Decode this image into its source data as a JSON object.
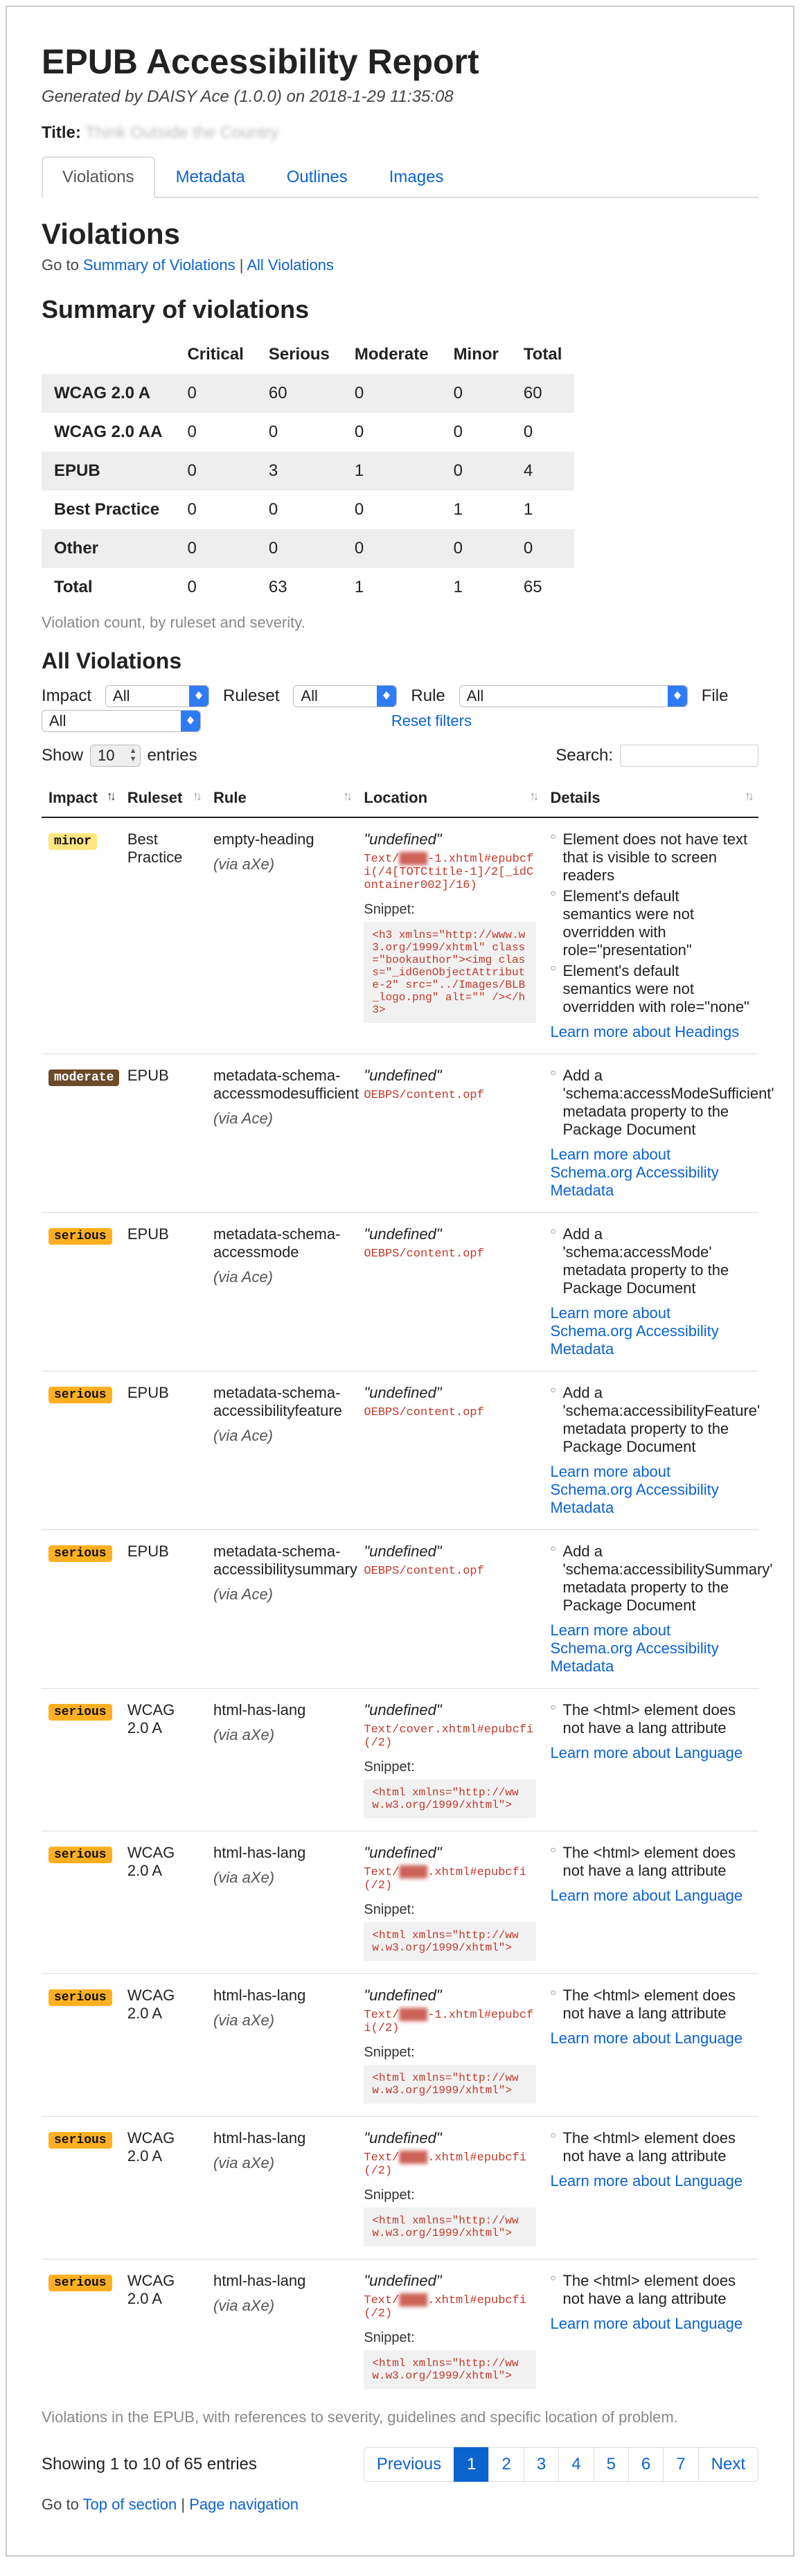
{
  "header": {
    "h1": "EPUB Accessibility Report",
    "generated_prefix": "Generated by ",
    "generated_tool": "DAISY Ace (1.0.0)",
    "generated_on": " on 2018-1-29 11:35:08",
    "title_label": "Title:",
    "title_value": "Think Outside the Country"
  },
  "tabs": [
    "Violations",
    "Metadata",
    "Outlines",
    "Images"
  ],
  "violations": {
    "h2": "Violations",
    "goto_prefix": "Go to ",
    "goto_link1": "Summary of Violations",
    "goto_sep": " | ",
    "goto_link2": "All Violations",
    "summary_h3": "Summary of violations",
    "summary_columns": [
      "Critical",
      "Serious",
      "Moderate",
      "Minor",
      "Total"
    ],
    "summary_rows": [
      {
        "label": "WCAG 2.0 A",
        "cells": [
          0,
          60,
          0,
          0,
          60
        ]
      },
      {
        "label": "WCAG 2.0 AA",
        "cells": [
          0,
          0,
          0,
          0,
          0
        ]
      },
      {
        "label": "EPUB",
        "cells": [
          0,
          3,
          1,
          0,
          4
        ]
      },
      {
        "label": "Best Practice",
        "cells": [
          0,
          0,
          0,
          1,
          1
        ]
      },
      {
        "label": "Other",
        "cells": [
          0,
          0,
          0,
          0,
          0
        ]
      },
      {
        "label": "Total",
        "cells": [
          0,
          63,
          1,
          1,
          65
        ]
      }
    ],
    "summary_caption": "Violation count, by ruleset and severity.",
    "all_h3": "All Violations",
    "filters": {
      "impact_label": "Impact",
      "impact_value": "All",
      "ruleset_label": "Ruleset",
      "ruleset_value": "All",
      "rule_label": "Rule",
      "rule_value": "All",
      "file_label": "File",
      "file_value": "All",
      "reset": "Reset filters"
    },
    "show_label_pre": "Show",
    "show_value": "10",
    "show_label_post": "entries",
    "search_label": "Search:",
    "columns": [
      "Impact",
      "Ruleset",
      "Rule",
      "Location",
      "Details"
    ],
    "rows": [
      {
        "impact": "minor",
        "ruleset": "Best Practice",
        "rule": "empty-heading",
        "via": "(via aXe)",
        "loc_head": "\"undefined\"",
        "loc_path": "Text/▮▮▮▮-1.xhtml#epubcfi(/4[TOTCtitle-1]/2[_idContainer002]/16)",
        "snippet": "<h3 xmlns=\"http://www.w3.org/1999/xhtml\" class=\"bookauthor\"><img class=\"_idGenObjectAttribute-2\" src=\"../Images/BLB_logo.png\" alt=\"\" /></h3>",
        "details": [
          "Element does not have text that is visible to screen readers",
          "Element's default semantics were not overridden with role=\"presentation\"",
          "Element's default semantics were not overridden with role=\"none\""
        ],
        "learn": "Learn more about Headings"
      },
      {
        "impact": "moderate",
        "ruleset": "EPUB",
        "rule": "metadata-schema-accessmodesufficient",
        "via": "(via Ace)",
        "loc_head": "\"undefined\"",
        "loc_path": "OEBPS/content.opf",
        "snippet": "",
        "details": [
          "Add a 'schema:accessModeSufficient' metadata property to the Package Document"
        ],
        "learn": "Learn more about Schema.org Accessibility Metadata"
      },
      {
        "impact": "serious",
        "ruleset": "EPUB",
        "rule": "metadata-schema-accessmode",
        "via": "(via Ace)",
        "loc_head": "\"undefined\"",
        "loc_path": "OEBPS/content.opf",
        "snippet": "",
        "details": [
          "Add a 'schema:accessMode' metadata property to the Package Document"
        ],
        "learn": "Learn more about Schema.org Accessibility Metadata"
      },
      {
        "impact": "serious",
        "ruleset": "EPUB",
        "rule": "metadata-schema-accessibilityfeature",
        "via": "(via Ace)",
        "loc_head": "\"undefined\"",
        "loc_path": "OEBPS/content.opf",
        "snippet": "",
        "details": [
          "Add a 'schema:accessibilityFeature' metadata property to the Package Document"
        ],
        "learn": "Learn more about Schema.org Accessibility Metadata"
      },
      {
        "impact": "serious",
        "ruleset": "EPUB",
        "rule": "metadata-schema-accessibilitysummary",
        "via": "(via Ace)",
        "loc_head": "\"undefined\"",
        "loc_path": "OEBPS/content.opf",
        "snippet": "",
        "details": [
          "Add a 'schema:accessibilitySummary' metadata property to the Package Document"
        ],
        "learn": "Learn more about Schema.org Accessibility Metadata"
      },
      {
        "impact": "serious",
        "ruleset": "WCAG 2.0 A",
        "rule": "html-has-lang",
        "via": "(via aXe)",
        "loc_head": "\"undefined\"",
        "loc_path": "Text/cover.xhtml#epubcfi(/2)",
        "snippet": "<html xmlns=\"http://www.w3.org/1999/xhtml\">",
        "details": [
          "The <html> element does not have a lang attribute"
        ],
        "learn": "Learn more about Language"
      },
      {
        "impact": "serious",
        "ruleset": "WCAG 2.0 A",
        "rule": "html-has-lang",
        "via": "(via aXe)",
        "loc_head": "\"undefined\"",
        "loc_path": "Text/▮▮▮▮.xhtml#epubcfi(/2)",
        "snippet": "<html xmlns=\"http://www.w3.org/1999/xhtml\">",
        "details": [
          "The <html> element does not have a lang attribute"
        ],
        "learn": "Learn more about Language"
      },
      {
        "impact": "serious",
        "ruleset": "WCAG 2.0 A",
        "rule": "html-has-lang",
        "via": "(via aXe)",
        "loc_head": "\"undefined\"",
        "loc_path": "Text/▮▮▮▮-1.xhtml#epubcfi(/2)",
        "snippet": "<html xmlns=\"http://www.w3.org/1999/xhtml\">",
        "details": [
          "The <html> element does not have a lang attribute"
        ],
        "learn": "Learn more about Language"
      },
      {
        "impact": "serious",
        "ruleset": "WCAG 2.0 A",
        "rule": "html-has-lang",
        "via": "(via aXe)",
        "loc_head": "\"undefined\"",
        "loc_path": "Text/▮▮▮▮▮▮.xhtml#epubcfi(/2)",
        "snippet": "<html xmlns=\"http://www.w3.org/1999/xhtml\">",
        "details": [
          "The <html> element does not have a lang attribute"
        ],
        "learn": "Learn more about Language"
      },
      {
        "impact": "serious",
        "ruleset": "WCAG 2.0 A",
        "rule": "html-has-lang",
        "via": "(via aXe)",
        "loc_head": "\"undefined\"",
        "loc_path": "Text/▮▮▮▮.xhtml#epubcfi(/2)",
        "snippet": "<html xmlns=\"http://www.w3.org/1999/xhtml\">",
        "details": [
          "The <html> element does not have a lang attribute"
        ],
        "learn": "Learn more about Language"
      }
    ],
    "table_caption": "Violations in the EPUB, with references to severity, guidelines and specific location of problem.",
    "showing": "Showing 1 to 10 of 65 entries",
    "pager": {
      "prev": "Previous",
      "pages": [
        "1",
        "2",
        "3",
        "4",
        "5",
        "6",
        "7"
      ],
      "next": "Next"
    },
    "bottom_goto_prefix": "Go to ",
    "bottom_goto_link1": "Top of section",
    "bottom_goto_sep": " | ",
    "bottom_goto_link2": "Page navigation"
  },
  "labels": {
    "snippet": "Snippet:"
  }
}
